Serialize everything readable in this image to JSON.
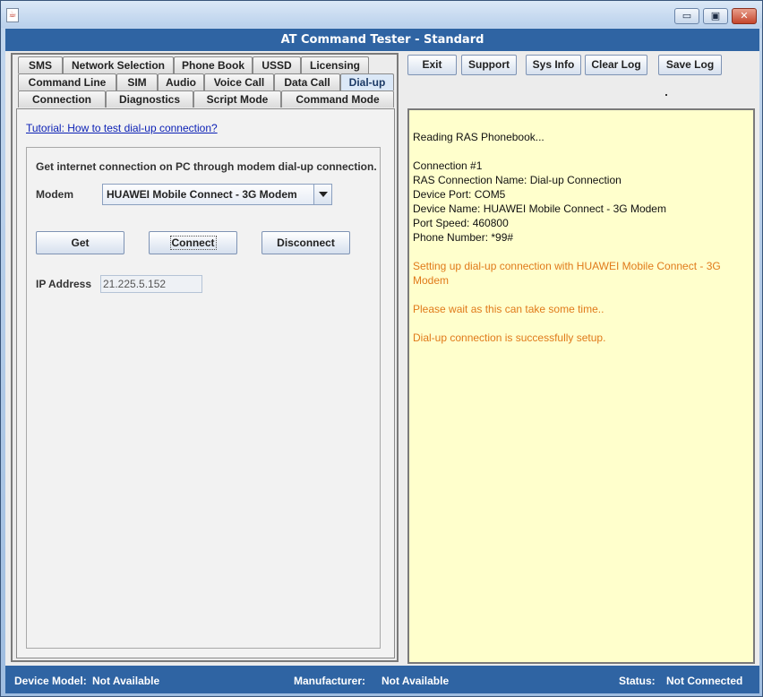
{
  "window": {
    "title": "AT Command Tester - Standard",
    "minimize": "▭",
    "maximize": "▣",
    "close": "✕"
  },
  "tabs": {
    "row1": [
      "SMS",
      "Network Selection",
      "Phone Book",
      "USSD",
      "Licensing"
    ],
    "row2": [
      "Command Line",
      "SIM",
      "Audio",
      "Voice Call",
      "Data Call",
      "Dial-up"
    ],
    "row3": [
      "Connection",
      "Diagnostics",
      "Script Mode",
      "Command Mode"
    ],
    "active": "Dial-up"
  },
  "dialup": {
    "tutorial_link": "Tutorial: How to test dial-up connection?",
    "description": "Get internet connection on PC through modem dial-up connection.",
    "modem_label": "Modem",
    "modem_value": "HUAWEI Mobile Connect - 3G Modem",
    "get_label": "Get",
    "connect_label": "Connect",
    "disconnect_label": "Disconnect",
    "ip_label": "IP Address",
    "ip_value": "21.225.5.152"
  },
  "toolbar": {
    "exit": "Exit",
    "support": "Support",
    "sysinfo": "Sys Info",
    "clearlog": "Clear Log",
    "savelog": "Save Log"
  },
  "log": {
    "lines": [
      {
        "text": "Reading RAS Phonebook...",
        "color": "black"
      },
      {
        "text": "",
        "color": "black"
      },
      {
        "text": "Connection #1",
        "color": "black"
      },
      {
        "text": "RAS Connection Name: Dial-up Connection",
        "color": "black"
      },
      {
        "text": "Device Port: COM5",
        "color": "black"
      },
      {
        "text": "Device Name: HUAWEI Mobile Connect - 3G Modem",
        "color": "black"
      },
      {
        "text": "Port Speed: 460800",
        "color": "black"
      },
      {
        "text": "Phone Number: *99#",
        "color": "black"
      },
      {
        "text": "",
        "color": "black"
      },
      {
        "text": "Setting up dial-up connection with HUAWEI Mobile Connect - 3G Modem",
        "color": "orange"
      },
      {
        "text": "",
        "color": "orange"
      },
      {
        "text": "Please wait as this can take some time..",
        "color": "orange"
      },
      {
        "text": "",
        "color": "orange"
      },
      {
        "text": "Dial-up connection is successfully setup.",
        "color": "orange"
      }
    ]
  },
  "statusbar": {
    "device_model_label": "Device Model:",
    "device_model_value": "Not Available",
    "manufacturer_label": "Manufacturer:",
    "manufacturer_value": "Not Available",
    "status_label": "Status:",
    "status_value": "Not Connected"
  },
  "colors": {
    "titlebar_blue": "#2f64a3",
    "log_background": "#ffffcc",
    "log_orange": "#e07a1a",
    "link_blue": "#0a1fb5"
  }
}
